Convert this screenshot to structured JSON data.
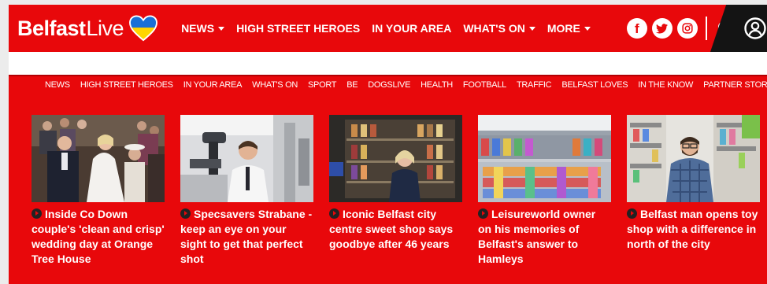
{
  "brand": {
    "logo_part1": "Belfast",
    "logo_part2": "Live",
    "brand_color": "#e8080b"
  },
  "main_nav": [
    {
      "label": "NEWS",
      "dropdown": true
    },
    {
      "label": "HIGH STREET HEROES",
      "dropdown": false
    },
    {
      "label": "IN YOUR AREA",
      "dropdown": false
    },
    {
      "label": "WHAT'S ON",
      "dropdown": true
    },
    {
      "label": "MORE",
      "dropdown": true
    }
  ],
  "social": {
    "facebook": "f",
    "twitter": "twitter-icon",
    "instagram": "instagram-icon"
  },
  "sub_nav": [
    "NEWS",
    "HIGH STREET HEROES",
    "IN YOUR AREA",
    "WHAT'S ON",
    "SPORT",
    "BE",
    "DOGSLIVE",
    "HEALTH",
    "FOOTBALL",
    "TRAFFIC",
    "BELFAST LOVES",
    "IN THE KNOW",
    "PARTNER STORIES"
  ],
  "cards": [
    {
      "headline": "Inside Co Down couple's 'clean and crisp' wedding day at Orange Tree House",
      "image": "wedding-photo"
    },
    {
      "headline": "Specsavers Strabane - keep an eye on your sight to get that perfect shot",
      "image": "optician-photo"
    },
    {
      "headline": "Iconic Belfast city centre sweet shop says goodbye after 46 years",
      "image": "sweet-shop-photo"
    },
    {
      "headline": "Leisureworld owner on his memories of Belfast's answer to Hamleys",
      "image": "toy-store-photo"
    },
    {
      "headline": "Belfast man opens toy shop with a difference in north of the city",
      "image": "toy-shop-owner-photo"
    }
  ]
}
